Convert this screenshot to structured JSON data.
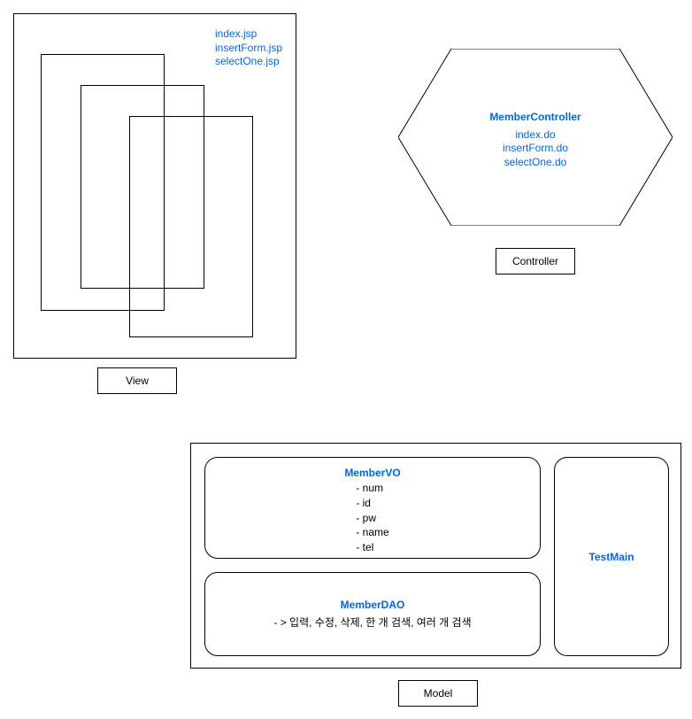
{
  "view": {
    "files": [
      "index.jsp",
      "insertForm.jsp",
      "selectOne.jsp"
    ],
    "label": "View"
  },
  "controller": {
    "title": "MemberController",
    "endpoints": [
      "index.do",
      "insertForm.do",
      "selectOne.do"
    ],
    "label": "Controller"
  },
  "model": {
    "memberVO": {
      "title": "MemberVO",
      "fields": [
        "- num",
        "- id",
        "- pw",
        "- name",
        "- tel"
      ]
    },
    "memberDAO": {
      "title": "MemberDAO",
      "operations": "- > 입력, 수정, 삭제, 한 개 검색, 여러 개 검색"
    },
    "testMain": {
      "title": "TestMain"
    },
    "label": "Model"
  }
}
